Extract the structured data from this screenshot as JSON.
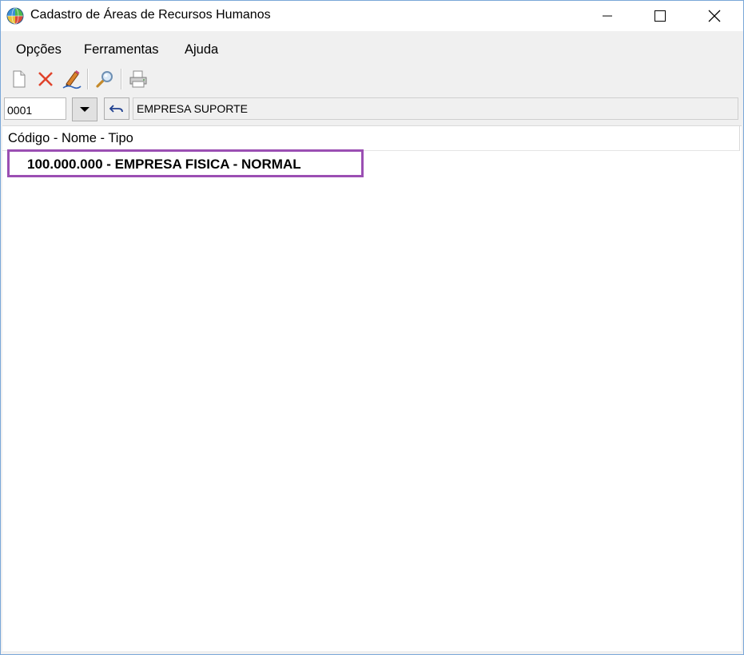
{
  "window": {
    "title": "Cadastro de Áreas de Recursos Humanos",
    "icons": {
      "app": "globe-icon",
      "minimize": "minimize-icon",
      "maximize": "maximize-icon",
      "close": "close-icon"
    }
  },
  "menu": {
    "items": [
      {
        "label": "Opções"
      },
      {
        "label": "Ferramentas"
      },
      {
        "label": "Ajuda"
      }
    ]
  },
  "toolbar": {
    "buttons": [
      {
        "icon": "new-document-icon"
      },
      {
        "icon": "delete-x-icon"
      },
      {
        "icon": "edit-pencil-icon"
      },
      {
        "icon": "search-magnifier-icon"
      },
      {
        "icon": "printer-icon"
      }
    ]
  },
  "company": {
    "code": "0001",
    "name": "EMPRESA SUPORTE",
    "icons": {
      "dropdown": "caret-down-icon",
      "undo": "undo-arrow-icon"
    }
  },
  "list": {
    "header": "Código - Nome - Tipo",
    "rows": [
      {
        "text": "100.000.000 - EMPRESA FISICA - NORMAL",
        "highlighted": true
      }
    ]
  },
  "colors": {
    "highlight_border": "#9b4fb3",
    "delete_red": "#e0432b",
    "window_border": "#7aa7d8"
  }
}
